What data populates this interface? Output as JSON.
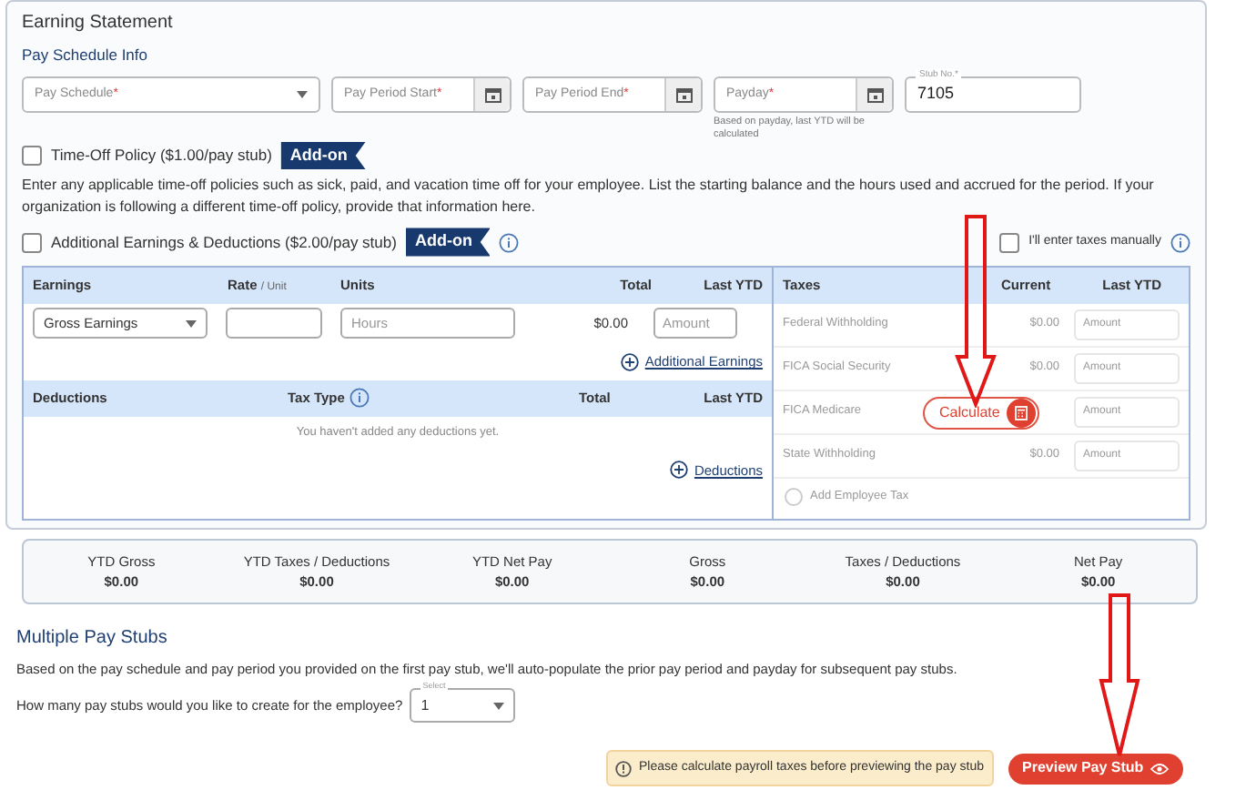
{
  "section": {
    "title": "Earning Statement",
    "subtitle": "Pay Schedule Info"
  },
  "schedule_fields": [
    {
      "kind": "select",
      "placeholder": "Pay Schedule",
      "required_mark": "*"
    },
    {
      "kind": "date",
      "placeholder": "Pay Period Start",
      "required_mark": "*"
    },
    {
      "kind": "date",
      "placeholder": "Pay Period End",
      "required_mark": "*"
    },
    {
      "kind": "date",
      "placeholder": "Payday",
      "required_mark": "*",
      "hint": "Based on payday, last YTD will be calculated"
    },
    {
      "kind": "text",
      "label": "Stub No.*",
      "value": "7105"
    }
  ],
  "time_off": {
    "label": "Time-Off Policy ($1.00/pay stub)",
    "checked": false,
    "badge": "Add-on",
    "description": "Enter any applicable time-off policies such as sick, paid, and vacation time off for your employee. List the starting balance and the hours used and accrued for the period. If your organization is following a different time-off policy, provide that information here."
  },
  "additional": {
    "label": "Additional Earnings & Deductions ($2.00/pay stub)",
    "checked": false,
    "badge": "Add-on"
  },
  "manual_taxes": {
    "label": "I'll enter taxes manually",
    "checked": false
  },
  "earnings": {
    "columns": [
      "Earnings",
      "Rate",
      "Units",
      "Total",
      "Last YTD"
    ],
    "rate_suffix": "/ Unit",
    "row": {
      "type": "Gross Earnings",
      "units_placeholder": "Hours",
      "total": "$0.00",
      "ytd_placeholder": "Amount"
    },
    "link": "Additional Earnings"
  },
  "deductions": {
    "columns": [
      "Deductions",
      "Tax Type",
      "Total",
      "Last YTD"
    ],
    "empty": "You haven't added any deductions yet.",
    "link": "Deductions"
  },
  "taxes": {
    "columns": [
      "Taxes",
      "Current",
      "Last YTD"
    ],
    "rows": [
      {
        "name": "Federal Withholding",
        "current": "$0.00",
        "ytd_placeholder": "Amount"
      },
      {
        "name": "FICA Social Security",
        "current": "$0.00",
        "ytd_placeholder": "Amount"
      },
      {
        "name": "FICA Medicare",
        "ytd_placeholder": "Amount"
      },
      {
        "name": "State Withholding",
        "current": "$0.00",
        "ytd_placeholder": "Amount"
      }
    ],
    "add_label": "Add Employee Tax",
    "add_checked": false,
    "calculate": "Calculate"
  },
  "summary": [
    {
      "label": "YTD Gross",
      "value": "$0.00"
    },
    {
      "label": "YTD Taxes / Deductions",
      "value": "$0.00"
    },
    {
      "label": "YTD Net Pay",
      "value": "$0.00"
    },
    {
      "label": "Gross",
      "value": "$0.00"
    },
    {
      "label": "Taxes / Deductions",
      "value": "$0.00"
    },
    {
      "label": "Net Pay",
      "value": "$0.00"
    }
  ],
  "multiple": {
    "title": "Multiple Pay Stubs",
    "text": "Based on the pay schedule and pay period you provided on the first pay stub, we'll auto-populate the prior pay period and payday for subsequent pay stubs.",
    "question": "How many pay stubs would you like to create for the employee?",
    "select_label": "Select",
    "value": "1"
  },
  "footer": {
    "warning": "Please calculate payroll taxes before previewing the pay stub",
    "button": "Preview Pay Stub"
  }
}
